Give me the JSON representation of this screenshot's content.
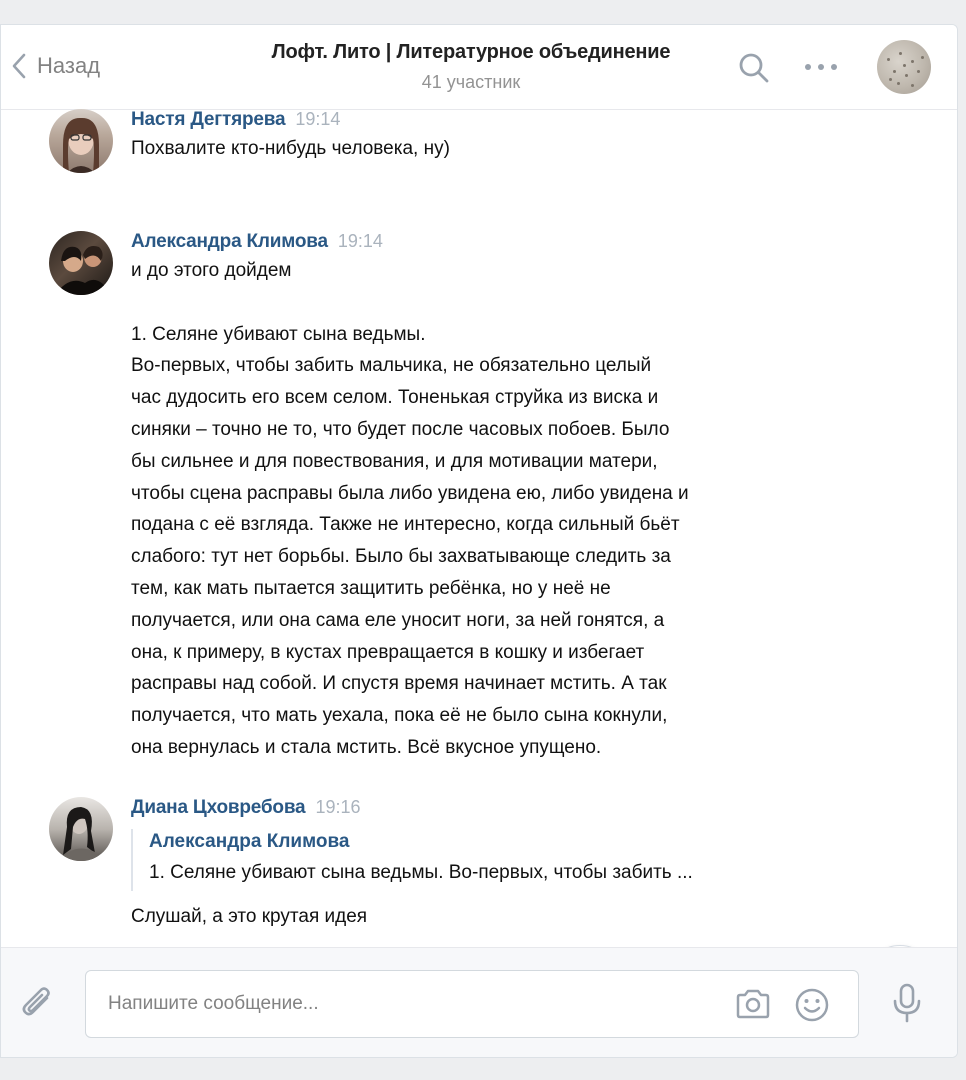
{
  "header": {
    "back_label": "Назад",
    "title": "Лофт. Лито | Литературное объединение",
    "subtitle": "41 участник"
  },
  "messages": [
    {
      "author": "Настя Дегтярева",
      "time": "19:14",
      "text": "Похвалите кто-нибудь человека, ну)"
    },
    {
      "author": "Александра Климова",
      "time": "19:14",
      "text": "и до этого дойдем\n\n1. Селяне убивают сына ведьмы.\nВо-первых, чтобы забить мальчика, не обязательно целый\nчас дудосить его всем селом. Тоненькая струйка из виска и\nсиняки – точно не то, что будет после часовых побоев. Было\nбы сильнее и для повествования, и для мотивации матери,\nчтобы сцена расправы была либо увидена ею, либо увидена и\nподана с её взгляда. Также не интересно, когда сильный бьёт\nслабого: тут нет борьбы. Было бы захватывающе следить за\nтем, как мать пытается защитить ребёнка, но у неё не\nполучается, или она сама еле уносит ноги, за ней гонятся, а\nона, к примеру, в кустах превращается в кошку и избегает\nрасправы над собой. И спустя время начинает мстить. А так\nполучается, что мать уехала, пока её не было сына кокнули,\nона вернулась и стала мстить. Всё вкусное упущено."
    },
    {
      "author": "Диана Цховребова",
      "time": "19:16",
      "quote_author": "Александра Климова",
      "quote_text": "1. Селяне убивают сына ведьмы. Во-первых, чтобы забить ...",
      "text": "Слушай, а это крутая идея"
    }
  ],
  "composer": {
    "placeholder": "Напишите сообщение..."
  },
  "colors": {
    "author_link": "#2a5885",
    "time": "#aab3bd",
    "icon": "#99a2ad"
  }
}
